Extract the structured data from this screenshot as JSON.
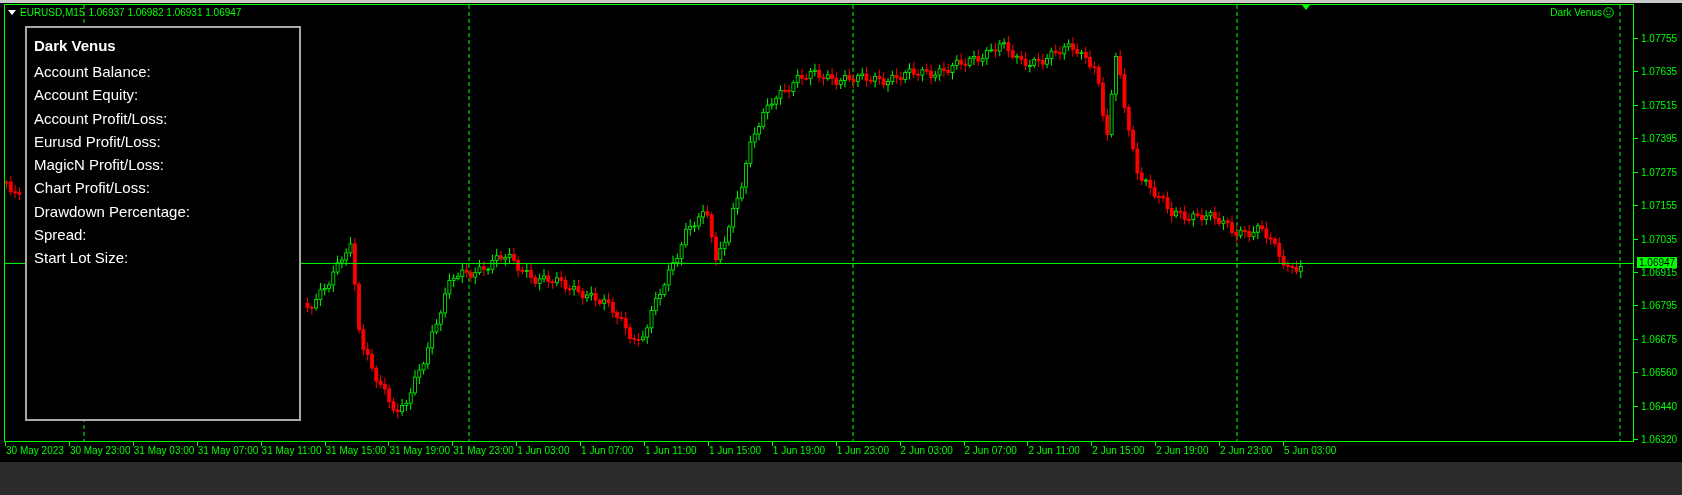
{
  "chart_header": {
    "symbol": "EURUSD,M15",
    "ohlc": "1.06937 1.06982 1.06931 1.06947"
  },
  "expert_label": {
    "name": "Dark Venus"
  },
  "info_panel": {
    "title": "Dark Venus",
    "lines": [
      "Account Balance:",
      "Account Equity:",
      "Account Profit/Loss:",
      "Eurusd Profit/Loss:",
      "MagicN Profit/Loss:",
      "Chart Profit/Loss:",
      "Drawdown Percentage:",
      "Spread:",
      "Start Lot Size:"
    ]
  },
  "price_axis": {
    "ticks": [
      "1.07755",
      "1.07635",
      "1.07515",
      "1.07395",
      "1.07275",
      "1.07155",
      "1.07035",
      "1.06915",
      "1.06795",
      "1.06675",
      "1.06560",
      "1.06440",
      "1.06320"
    ],
    "current_price": "1.06947"
  },
  "time_axis": {
    "labels": [
      "30 May 2023",
      "30 May 23:00",
      "31 May 03:00",
      "31 May 07:00",
      "31 May 11:00",
      "31 May 15:00",
      "31 May 19:00",
      "31 May 23:00",
      "1 Jun 03:00",
      "1 Jun 07:00",
      "1 Jun 11:00",
      "1 Jun 15:00",
      "1 Jun 19:00",
      "1 Jun 23:00",
      "2 Jun 03:00",
      "2 Jun 07:00",
      "2 Jun 11:00",
      "2 Jun 15:00",
      "2 Jun 19:00",
      "2 Jun 23:00",
      "5 Jun 03:00"
    ]
  }
}
